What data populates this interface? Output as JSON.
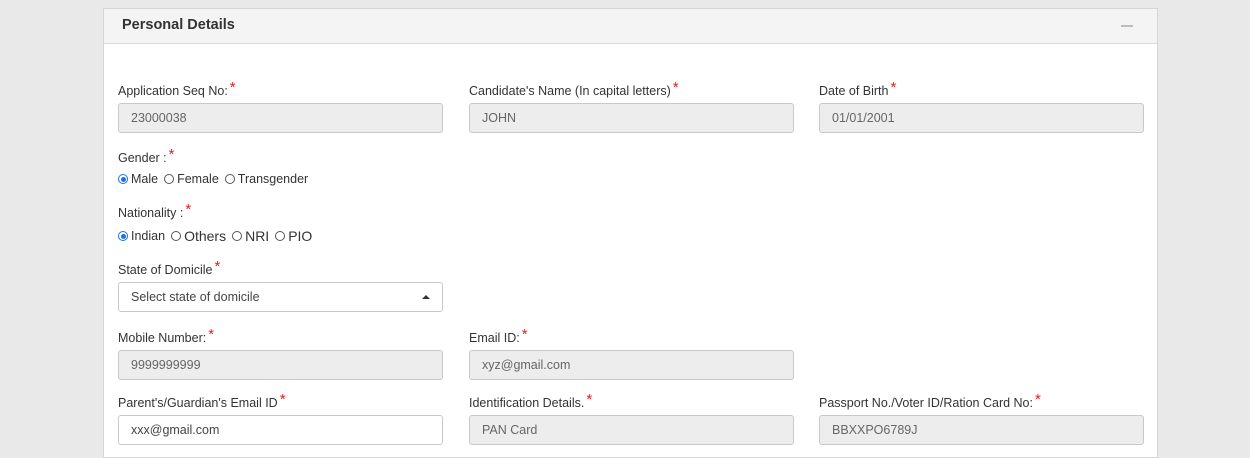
{
  "panel": {
    "title": "Personal Details"
  },
  "fields": {
    "app_seq": {
      "label": "Application Seq No:",
      "value": "23000038"
    },
    "name": {
      "label": "Candidate's Name (In capital letters)",
      "value": "JOHN"
    },
    "dob": {
      "label": "Date of Birth",
      "value": "01/01/2001"
    },
    "mobile": {
      "label": "Mobile Number:",
      "value": "9999999999"
    },
    "email": {
      "label": "Email ID:",
      "value": "xyz@gmail.com"
    },
    "guardian_email": {
      "label": "Parent's/Guardian's Email ID",
      "value": "xxx@gmail.com"
    },
    "identification": {
      "label": "Identification Details.",
      "value": "PAN Card"
    },
    "passport": {
      "label": "Passport No./Voter ID/Ration Card No:",
      "value": "BBXXPO6789J"
    }
  },
  "gender": {
    "label": "Gender :",
    "options": [
      "Male",
      "Female",
      "Transgender"
    ],
    "selected": "Male"
  },
  "nationality": {
    "label": "Nationality :",
    "options": [
      "Indian",
      "Others",
      "NRI",
      "PIO"
    ],
    "selected": "Indian"
  },
  "domicile": {
    "label": "State of Domicile",
    "placeholder": "Select state of domicile"
  },
  "required_mark": "*"
}
